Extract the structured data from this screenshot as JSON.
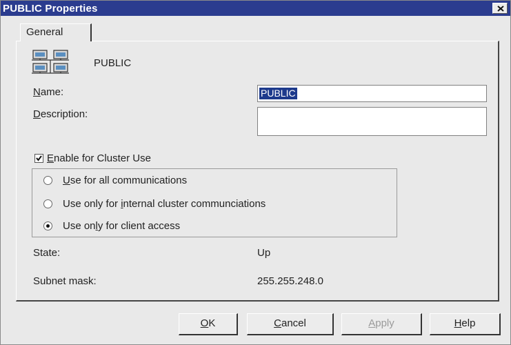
{
  "window": {
    "title": "PUBLIC Properties"
  },
  "tabs": [
    {
      "label": "General"
    }
  ],
  "network": {
    "name_display": "PUBLIC",
    "icon": "network-computers-icon"
  },
  "fields": {
    "name_label": "Name:",
    "name_value": "PUBLIC",
    "description_label": "Description:",
    "description_value": ""
  },
  "cluster": {
    "enable_label": "Enable for Cluster Use",
    "enabled": true,
    "options": [
      {
        "label": "Use for all communications",
        "selected": false
      },
      {
        "label": "Use only for internal cluster communciations",
        "selected": false
      },
      {
        "label": "Use only for client access",
        "selected": true
      }
    ]
  },
  "info": {
    "state_label": "State:",
    "state_value": "Up",
    "subnet_label": "Subnet mask:",
    "subnet_value": "255.255.248.0"
  },
  "buttons": {
    "ok": "OK",
    "cancel": "Cancel",
    "apply": "Apply",
    "help": "Help"
  },
  "colors": {
    "titlebar": "#2b3c8f",
    "selection": "#1d3a8c",
    "face": "#e9e9e9"
  }
}
